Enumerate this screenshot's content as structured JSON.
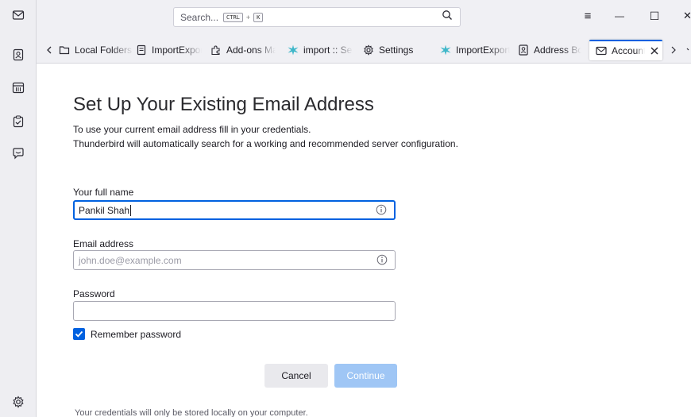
{
  "spaces": {
    "items": [
      {
        "name": "mail-icon"
      },
      {
        "name": "address-book-icon"
      },
      {
        "name": "calendar-icon"
      },
      {
        "name": "tasks-icon"
      },
      {
        "name": "chat-icon"
      }
    ],
    "settings": {
      "name": "settings-gear-icon"
    }
  },
  "search": {
    "placeholder": "Search...",
    "shortcut_key1": "CTRL",
    "shortcut_plus": "+",
    "shortcut_key2": "K"
  },
  "window_controls": {
    "menu": "≡",
    "minimize": "—",
    "maximize": "☐",
    "close": "✕"
  },
  "tabs": [
    {
      "label": "Local Folders",
      "icon": "folder-icon"
    },
    {
      "label": "ImportExportTools",
      "icon": "document-icon"
    },
    {
      "label": "Add-ons Manager",
      "icon": "puzzle-icon"
    },
    {
      "label": "import :: Search",
      "icon": "addon-star-icon"
    },
    {
      "label": "Settings",
      "icon": "gear-icon"
    },
    {
      "label": "ImportExportTools",
      "icon": "addon-star-icon"
    },
    {
      "label": "Address Book",
      "icon": "address-book-icon"
    },
    {
      "label": "Account Setup",
      "icon": "mail-icon",
      "active": true
    }
  ],
  "page": {
    "title": "Set Up Your Existing Email Address",
    "intro_line1": "To use your current email address fill in your credentials.",
    "intro_line2": "Thunderbird will automatically search for a working and recommended server configuration.",
    "full_name": {
      "label": "Your full name",
      "value": "Pankil Shah"
    },
    "email": {
      "label": "Email address",
      "placeholder": "john.doe@example.com"
    },
    "password": {
      "label": "Password",
      "value": ""
    },
    "remember": {
      "label": "Remember password",
      "checked": true
    },
    "cancel_label": "Cancel",
    "continue_label": "Continue",
    "footnote": "Your credentials will only be stored locally on your computer."
  },
  "colors": {
    "accent": "#0061e0",
    "continue_disabled": "#9fc6f5",
    "addon_icon": "#3fb7c9"
  }
}
